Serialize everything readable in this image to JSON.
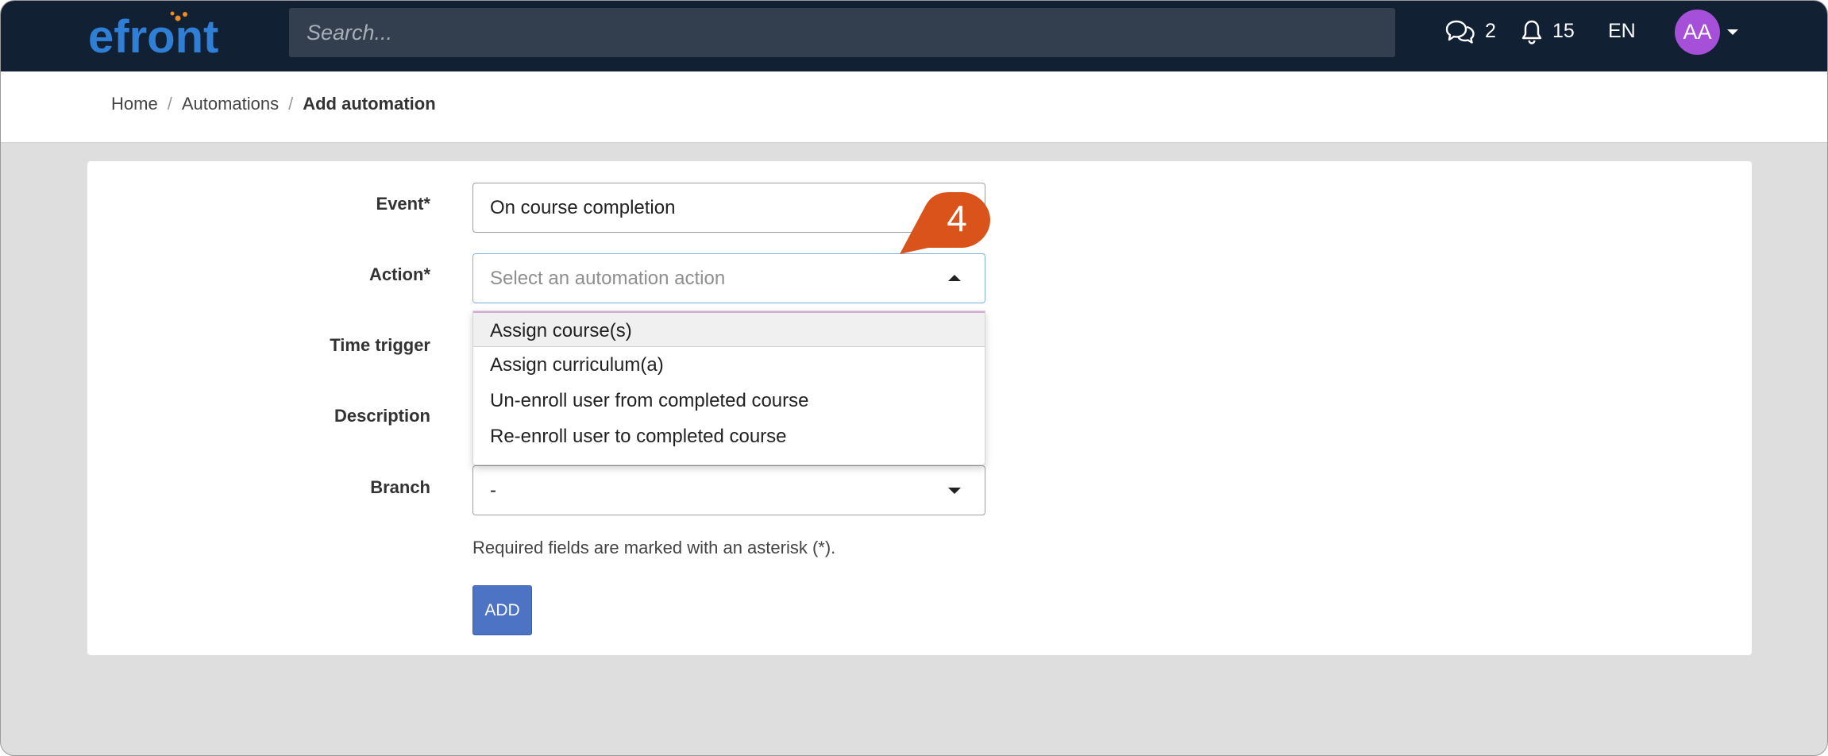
{
  "header": {
    "logo_text": "efront",
    "search_placeholder": "Search...",
    "messages_count": "2",
    "notifications_count": "15",
    "language": "EN",
    "avatar_initials": "AA"
  },
  "breadcrumb": {
    "items": [
      "Home",
      "Automations"
    ],
    "current": "Add automation"
  },
  "form": {
    "event_label": "Event*",
    "event_value": "On course completion",
    "action_label": "Action*",
    "action_placeholder": "Select an automation action",
    "time_trigger_label": "Time trigger",
    "description_label": "Description",
    "branch_label": "Branch",
    "branch_value": "-",
    "required_note": "Required fields are marked with an asterisk (*).",
    "add_button": "ADD"
  },
  "action_dropdown": {
    "options": [
      "Assign course(s)",
      "Assign curriculum(a)",
      "Un-enroll user from completed course",
      "Re-enroll user to completed course"
    ],
    "highlighted_index": 0
  },
  "callout": {
    "number": "4"
  },
  "colors": {
    "topbar": "#122034",
    "logo_blue": "#2f7fd6",
    "logo_orange": "#f08a24",
    "avatar": "#a64fd8",
    "add_button": "#4d73c4",
    "callout": "#d9531b"
  }
}
